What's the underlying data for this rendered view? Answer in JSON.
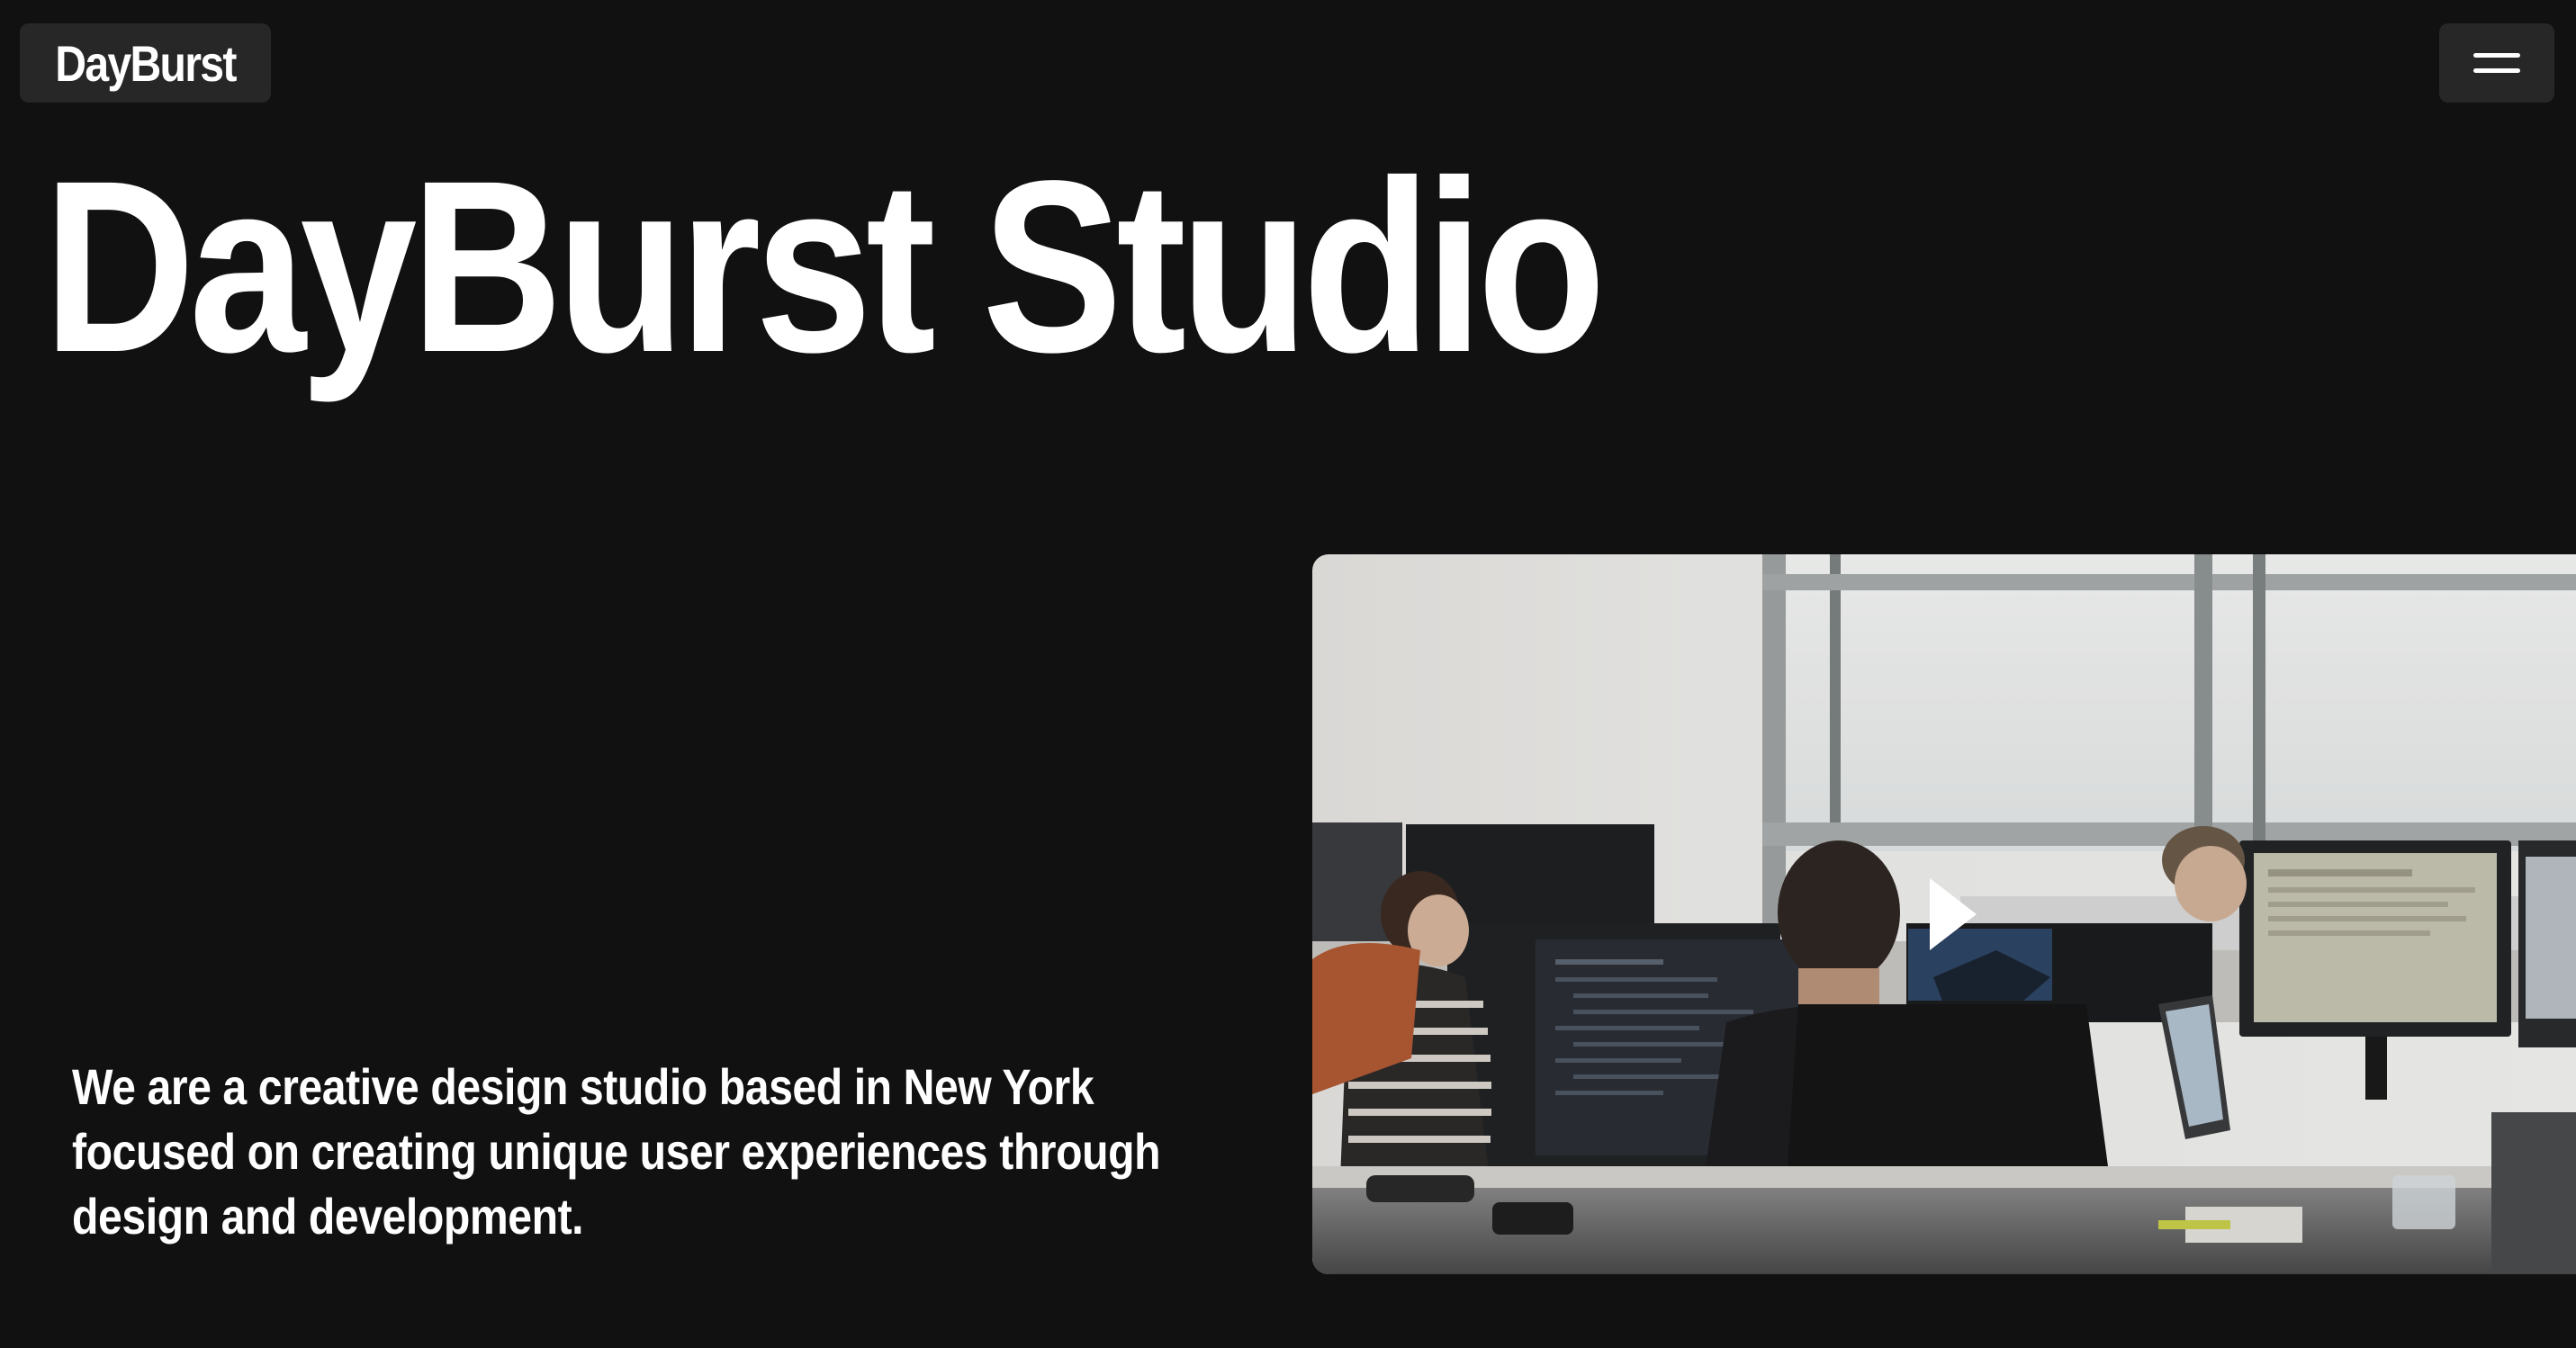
{
  "header": {
    "logo_label": "DayBurst",
    "menu_icon": "menu-icon"
  },
  "hero": {
    "title": "DayBurst Studio",
    "tagline": "We are a creative design studio based in New York focused on creating unique user experiences through design and development."
  },
  "media": {
    "image_subject": "people working at computer monitors in a bright open-plan office",
    "play_icon": "play-icon"
  },
  "colors": {
    "background": "#111111",
    "pill_background": "#272727",
    "text": "#ffffff"
  }
}
